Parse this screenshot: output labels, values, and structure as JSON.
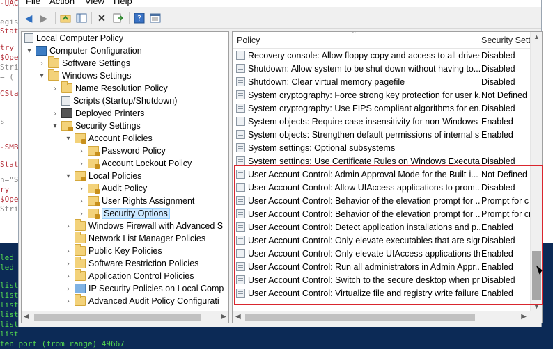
{
  "background_editor": {
    "lines": [
      "-UAC",
      "egis",
      "Stat",
      "try",
      "$Ope",
      "Stri",
      "= (",
      "CStat",
      "s",
      "-SMB",
      "Stat",
      "n=\"S",
      "ry",
      "$Ope",
      "Stri"
    ]
  },
  "background_console": {
    "lines": [
      "led",
      "led",
      "list",
      "list",
      "list",
      "list",
      "list",
      "list",
      "list",
      "ten port (from range)   49667"
    ]
  },
  "menu": [
    "File",
    "Action",
    "View",
    "Help"
  ],
  "toolbar": {
    "icons": [
      "back-icon",
      "forward-icon",
      "up-folder-icon",
      "show-hide-tree-icon",
      "delete-icon",
      "export-list-icon",
      "help-icon",
      "properties-icon"
    ]
  },
  "tree": {
    "items": [
      {
        "label": "Local Computer Policy",
        "icon": "doc",
        "expander": ""
      },
      {
        "label": "Computer Configuration",
        "icon": "computer",
        "expander": "▾"
      },
      {
        "label": "Software Settings",
        "icon": "folder",
        "expander": "›"
      },
      {
        "label": "Windows Settings",
        "icon": "folder",
        "expander": "▾"
      },
      {
        "label": "Name Resolution Policy",
        "icon": "folder",
        "expander": "›"
      },
      {
        "label": "Scripts (Startup/Shutdown)",
        "icon": "doc",
        "expander": ""
      },
      {
        "label": "Deployed Printers",
        "icon": "printer",
        "expander": "›"
      },
      {
        "label": "Security Settings",
        "icon": "lockfolder",
        "expander": "▾"
      },
      {
        "label": "Account Policies",
        "icon": "lockfolder",
        "expander": "▾"
      },
      {
        "label": "Password Policy",
        "icon": "lockfolder",
        "expander": "›"
      },
      {
        "label": "Account Lockout Policy",
        "icon": "lockfolder",
        "expander": "›"
      },
      {
        "label": "Local Policies",
        "icon": "lockfolder",
        "expander": "▾"
      },
      {
        "label": "Audit Policy",
        "icon": "lockfolder",
        "expander": "›"
      },
      {
        "label": "User Rights Assignment",
        "icon": "lockfolder",
        "expander": "›"
      },
      {
        "label": "Security Options",
        "icon": "lockfolder",
        "expander": "›",
        "selected": true
      },
      {
        "label": "Windows Firewall with Advanced S",
        "icon": "folder",
        "expander": "›"
      },
      {
        "label": "Network List Manager Policies",
        "icon": "folder",
        "expander": ""
      },
      {
        "label": "Public Key Policies",
        "icon": "folder",
        "expander": "›"
      },
      {
        "label": "Software Restriction Policies",
        "icon": "folder",
        "expander": "›"
      },
      {
        "label": "Application Control Policies",
        "icon": "folder",
        "expander": "›"
      },
      {
        "label": "IP Security Policies on Local Comp",
        "icon": "shield",
        "expander": "›"
      },
      {
        "label": "Advanced Audit Policy Configurati",
        "icon": "folder",
        "expander": "›"
      }
    ]
  },
  "list": {
    "columns": [
      "Policy",
      "Security Setti"
    ],
    "rows": [
      {
        "policy": "Recovery console: Allow floppy copy and access to all drives...",
        "setting": "Disabled"
      },
      {
        "policy": "Shutdown: Allow system to be shut down without having to...",
        "setting": "Disabled"
      },
      {
        "policy": "Shutdown: Clear virtual memory pagefile",
        "setting": "Disabled"
      },
      {
        "policy": "System cryptography: Force strong key protection for user k...",
        "setting": "Not Defined"
      },
      {
        "policy": "System cryptography: Use FIPS compliant algorithms for en...",
        "setting": "Disabled"
      },
      {
        "policy": "System objects: Require case insensitivity for non-Windows ...",
        "setting": "Enabled"
      },
      {
        "policy": "System objects: Strengthen default permissions of internal s...",
        "setting": "Enabled"
      },
      {
        "policy": "System settings: Optional subsystems",
        "setting": ""
      },
      {
        "policy": "System settings: Use Certificate Rules on Windows Executabl...",
        "setting": "Disabled"
      },
      {
        "policy": "User Account Control: Admin Approval Mode for the Built-i...",
        "setting": "Not Defined"
      },
      {
        "policy": "User Account Control: Allow UIAccess applications to prom...",
        "setting": "Disabled"
      },
      {
        "policy": "User Account Control: Behavior of the elevation prompt for ...",
        "setting": "Prompt for c"
      },
      {
        "policy": "User Account Control: Behavior of the elevation prompt for ...",
        "setting": "Prompt for cr"
      },
      {
        "policy": "User Account Control: Detect application installations and p...",
        "setting": "Enabled"
      },
      {
        "policy": "User Account Control: Only elevate executables that are sign...",
        "setting": "Disabled"
      },
      {
        "policy": "User Account Control: Only elevate UIAccess applications th...",
        "setting": "Enabled"
      },
      {
        "policy": "User Account Control: Run all administrators in Admin Appr...",
        "setting": "Enabled"
      },
      {
        "policy": "User Account Control: Switch to the secure desktop when pr...",
        "setting": "Disabled"
      },
      {
        "policy": "User Account Control: Virtualize file and registry write failure...",
        "setting": "Enabled"
      }
    ]
  },
  "colors": {
    "highlight_box": "#d9262e",
    "selection": "#cce8ff"
  }
}
